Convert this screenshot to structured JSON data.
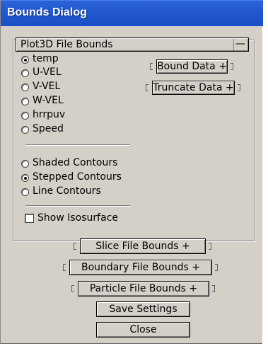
{
  "window": {
    "title": "Bounds Dialog"
  },
  "plot3d": {
    "header": "Plot3D File Bounds",
    "collapse_symbol": "—",
    "variables": [
      {
        "label": "temp",
        "selected": true
      },
      {
        "label": "U-VEL",
        "selected": false
      },
      {
        "label": "V-VEL",
        "selected": false
      },
      {
        "label": "W-VEL",
        "selected": false
      },
      {
        "label": "hrrpuv",
        "selected": false
      },
      {
        "label": "Speed",
        "selected": false
      }
    ],
    "contours": [
      {
        "label": "Shaded Contours",
        "selected": false
      },
      {
        "label": "Stepped Contours",
        "selected": true
      },
      {
        "label": "Line Contours",
        "selected": false
      }
    ],
    "isosurface": {
      "label": "Show Isosurface",
      "checked": false
    },
    "bound_data": "Bound Data +",
    "truncate_data": "Truncate Data +"
  },
  "rollouts": {
    "slice": "Slice File Bounds +",
    "boundary": "Boundary File Bounds +",
    "particle": "Particle File Bounds +"
  },
  "buttons": {
    "save": "Save Settings",
    "close": "Close"
  }
}
